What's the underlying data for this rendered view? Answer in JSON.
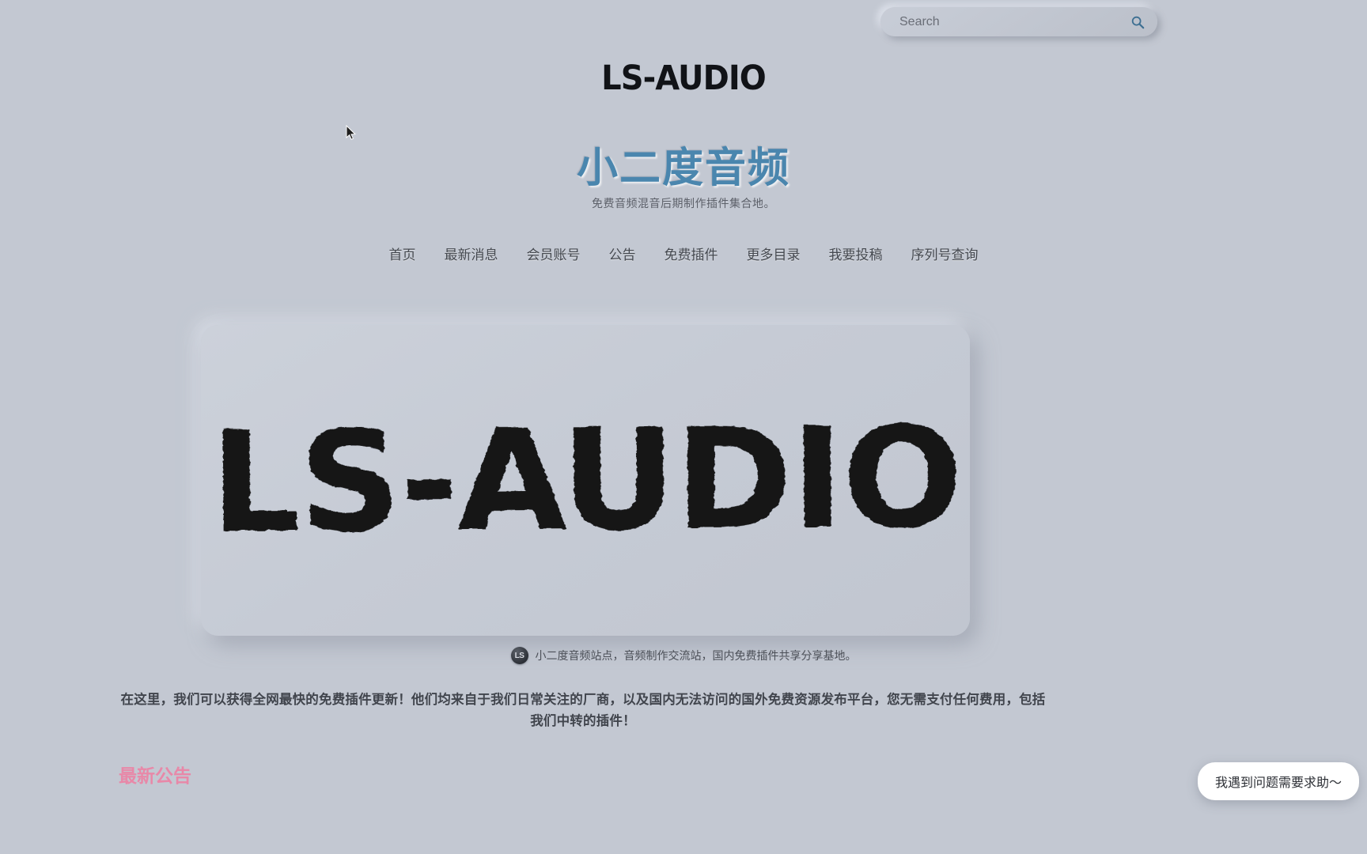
{
  "search": {
    "placeholder": "Search",
    "value": "",
    "icon": "search-icon"
  },
  "brand": {
    "logo_text": "LS-AUDIO"
  },
  "header": {
    "title": "小二度音频",
    "title_color": "#4a86ae",
    "tagline": "免费音频混音后期制作插件集合地。"
  },
  "nav": {
    "items": [
      {
        "label": "首页"
      },
      {
        "label": "最新消息"
      },
      {
        "label": "会员账号"
      },
      {
        "label": "公告"
      },
      {
        "label": "免费插件"
      },
      {
        "label": "更多目录"
      },
      {
        "label": "我要投稿"
      },
      {
        "label": "序列号查询"
      }
    ]
  },
  "hero": {
    "banner_text": "LS-AUDIO"
  },
  "caption": {
    "avatar_text": "LS",
    "text": "小二度音频站点，音频制作交流站，国内免费插件共享分享基地。"
  },
  "intro": {
    "text": "在这里，我们可以获得全网最快的免费插件更新！他们均来自于我们日常关注的厂商，以及国内无法访问的国外免费资源发布平台，您无需支付任何费用，包括我们中转的插件！"
  },
  "section": {
    "latest_announcement_heading": "最新公告",
    "heading_color": "#e888a8"
  },
  "chat": {
    "label": "我遇到问题需要求助～"
  },
  "theme": {
    "background": "#c3c8d2",
    "text_primary": "#41454d",
    "accent_blue": "#4a86ae",
    "accent_pink": "#e888a8"
  }
}
